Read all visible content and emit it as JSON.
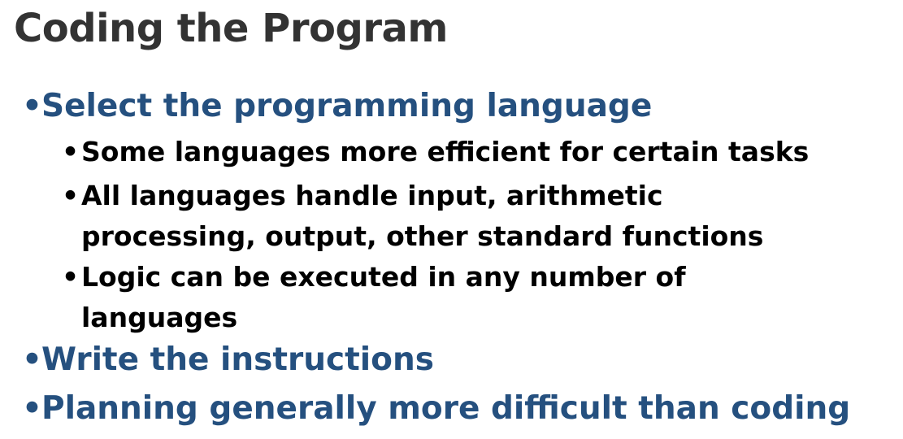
{
  "slide": {
    "title": "Coding the Program",
    "bullet_glyph": "•",
    "items": [
      {
        "level": 1,
        "text": "Select the programming language"
      },
      {
        "level": 2,
        "text": "Some languages more efficient for certain tasks"
      },
      {
        "level": 2,
        "line1": "All languages handle input, arithmetic",
        "line2": "processing, output, other standard functions"
      },
      {
        "level": 2,
        "line1": "Logic can be executed in any number of",
        "line2": "languages"
      },
      {
        "level": 1,
        "text": "Write the instructions"
      },
      {
        "level": 1,
        "text": "Planning generally more difficult than coding"
      }
    ]
  },
  "colors": {
    "title": "#333333",
    "level1": "#25507f",
    "level2": "#000000",
    "background": "#ffffff"
  }
}
